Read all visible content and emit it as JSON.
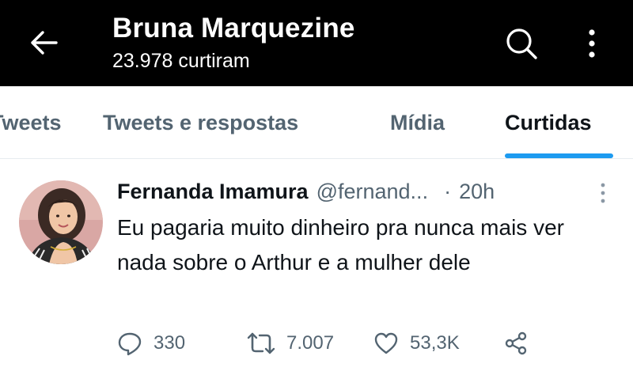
{
  "header": {
    "back_icon": "arrow-left-icon",
    "title": "Bruna Marquezine",
    "subtitle": "23.978 curtiram",
    "search_icon": "search-icon",
    "more_icon": "more-vertical-icon"
  },
  "tabs": [
    {
      "label": "Tweets",
      "active": false
    },
    {
      "label": "Tweets e respostas",
      "active": false
    },
    {
      "label": "Mídia",
      "active": false
    },
    {
      "label": "Curtidas",
      "active": true
    }
  ],
  "colors": {
    "accent": "#1d9bf0",
    "header_bg": "#000000",
    "secondary_text": "#536471",
    "primary_text": "#0f1419"
  },
  "tweet": {
    "author_name": "Fernanda Imamura",
    "author_handle": "@fernand...",
    "separator": "·",
    "time": "20h",
    "text": "Eu pagaria muito dinheiro pra nunca mais ver nada sobre o Arthur e a mulher dele",
    "replies": "330",
    "retweets": "7.007",
    "likes": "53,3K"
  }
}
